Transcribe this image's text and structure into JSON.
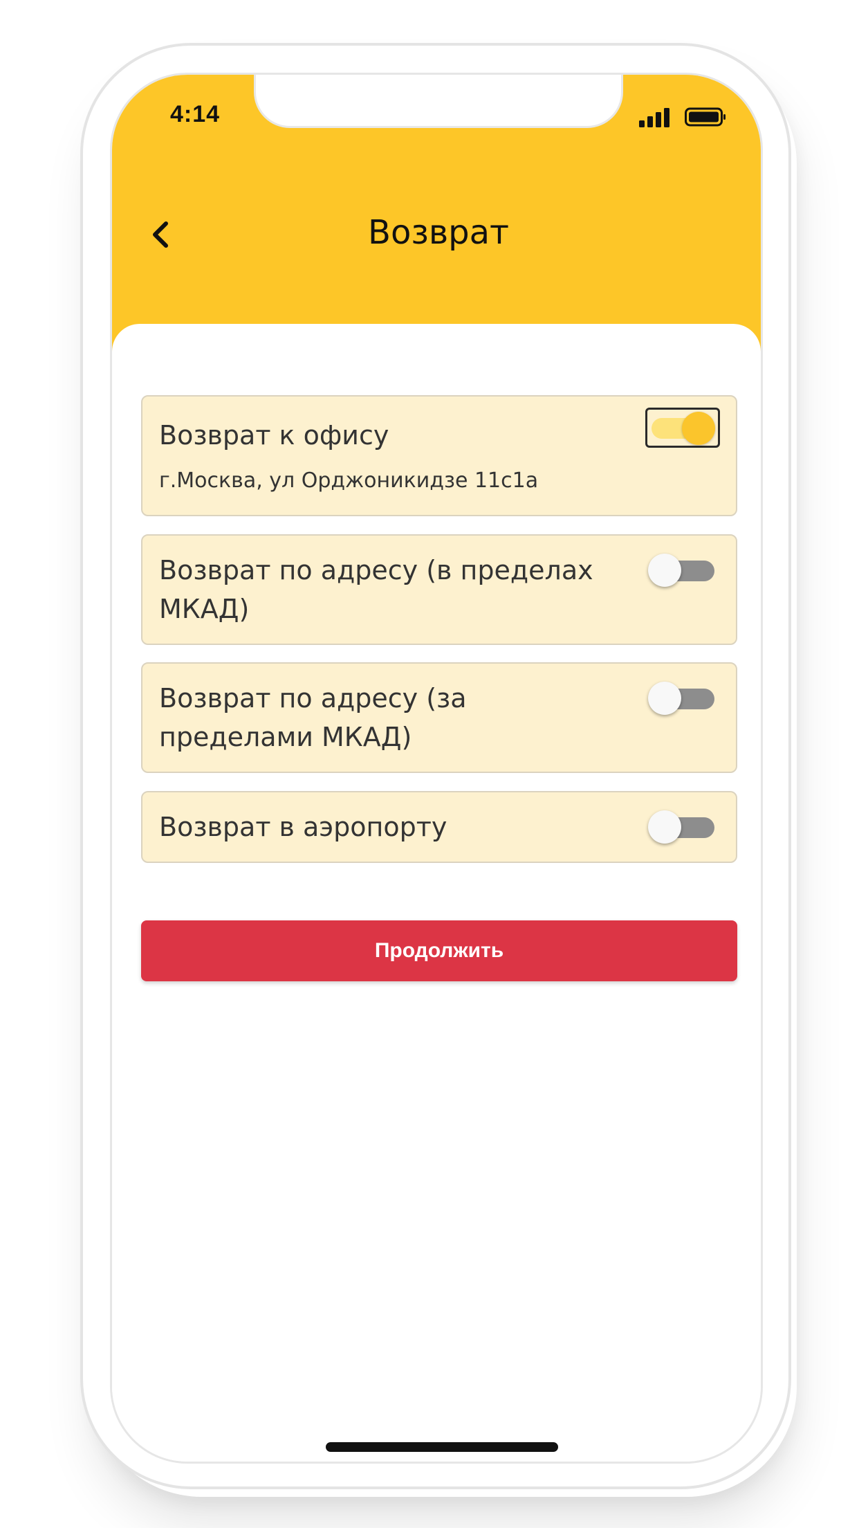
{
  "status_bar": {
    "time": "4:14",
    "signal_icon": "cellular-signal-icon",
    "battery_icon": "battery-full-icon"
  },
  "header": {
    "title": "Возврат",
    "back_icon": "chevron-left-icon"
  },
  "options": [
    {
      "label": "Возврат к офису",
      "address": "г.Москва, ул Орджоникидзе 11с1а",
      "enabled": true
    },
    {
      "label": "Возврат по адресу (в пределах МКАД)",
      "enabled": false
    },
    {
      "label": "Возврат по адресу (за пределами МКАД)",
      "enabled": false
    },
    {
      "label": "Возврат в аэропорту",
      "enabled": false
    }
  ],
  "continue_button": {
    "label": "Продолжить"
  },
  "colors": {
    "header": "#fdc628",
    "card": "#fdf1cf",
    "accent_button": "#dc3545",
    "toggle_on": "#fbc52c",
    "toggle_off": "#8d8d8d"
  }
}
